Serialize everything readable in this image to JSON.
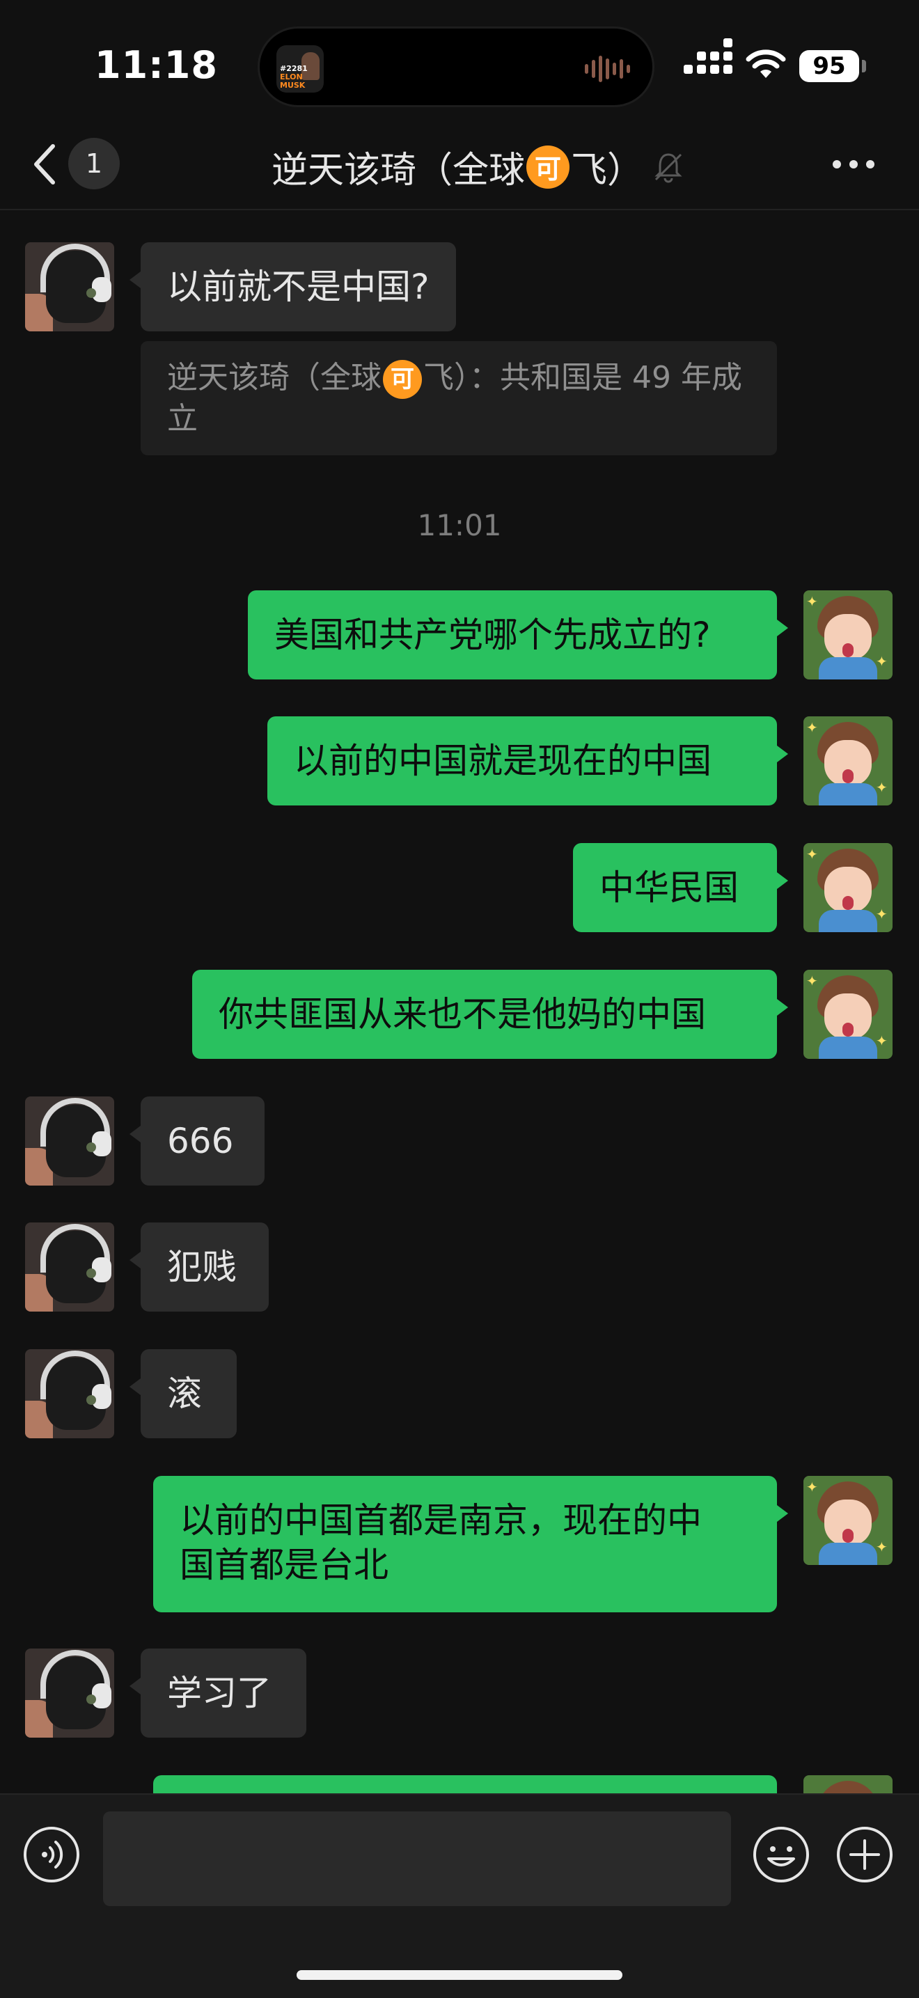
{
  "status_bar": {
    "time": "11:18",
    "battery": "95"
  },
  "island": {
    "line1": "#2281",
    "line2": "ELON",
    "line3": "MUSK"
  },
  "nav": {
    "unread_count": "1",
    "title_before": "逆天该琦（全球",
    "title_emoji": "可",
    "title_after": "飞）"
  },
  "messages": {
    "m1": "以前就不是中国?",
    "quote_before": "逆天该琦（全球",
    "quote_emoji": "可",
    "quote_after": "飞）：共和国是 49 年成立",
    "timestamp": "11:01",
    "m2": "美国和共产党哪个先成立的?",
    "m3": "以前的中国就是现在的中国",
    "m4": "中华民国",
    "m5": "你共匪国从来也不是他妈的中国",
    "m6": "666",
    "m7": "犯贱",
    "m8": "滚",
    "m9_line1": "以前的中国首都是南京，现在的中",
    "m9_line2": "国首都是台北",
    "m10": "学习了"
  },
  "colors": {
    "sent_bubble": "#29c15f",
    "received_bubble": "#2c2c2c",
    "background": "#111111"
  },
  "icons": [
    "back-chevron-icon",
    "mute-bell-icon",
    "more-dots-icon",
    "voice-icon",
    "emoji-icon",
    "plus-icon"
  ]
}
